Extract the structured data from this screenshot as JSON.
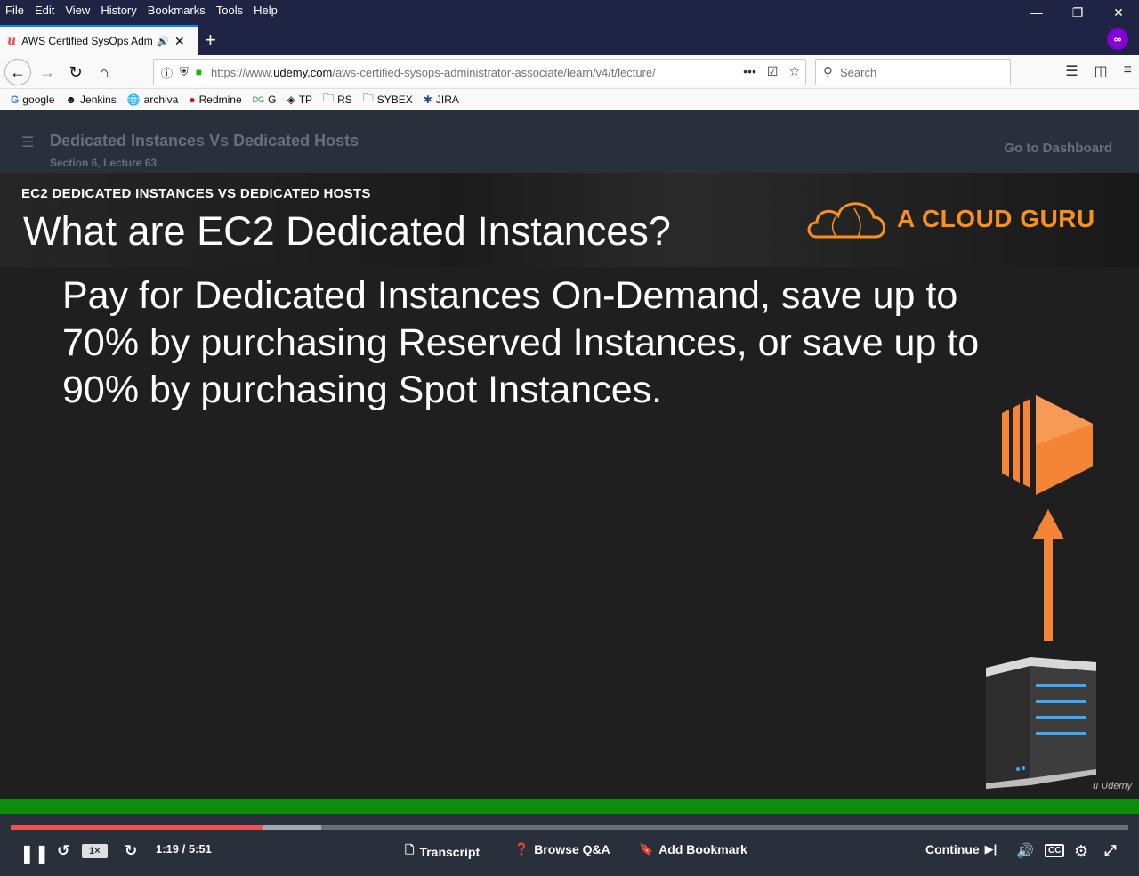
{
  "menu": [
    "File",
    "Edit",
    "View",
    "History",
    "Bookmarks",
    "Tools",
    "Help"
  ],
  "tab": {
    "title": "AWS Certified SysOps Administrator"
  },
  "url": {
    "prefix": "https://www.",
    "domain": "udemy.com",
    "path": "/aws-certified-sysops-administrator-associate/learn/v4/t/lecture/"
  },
  "search": {
    "placeholder": "Search"
  },
  "bookmarks": [
    "google",
    "Jenkins",
    "archiva",
    "Redmine",
    "G",
    "TP",
    "RS",
    "SYBEX",
    "JIRA"
  ],
  "lecture": {
    "title": "Dedicated Instances Vs Dedicated Hosts",
    "subtitle": "Section 6, Lecture 63",
    "dashboard": "Go to Dashboard"
  },
  "slide": {
    "kicker": "EC2 DEDICATED INSTANCES VS DEDICATED HOSTS",
    "title": "What are EC2 Dedicated Instances?",
    "brand": "A CLOUD GURU",
    "body": "Pay for Dedicated Instances On-Demand, save up to 70% by purchasing Reserved Instances, or save up to 90% by purchasing Spot Instances.",
    "watermark": "Udemy"
  },
  "player": {
    "speed": "1×",
    "time": "1:19 / 5:51",
    "played_fraction": 0.226,
    "buffered_fraction": 0.278,
    "transcript": "Transcript",
    "qa": "Browse Q&A",
    "bookmark": "Add Bookmark",
    "continue": "Continue"
  },
  "colors": {
    "accent": "#ec5252",
    "brand": "#f7901e",
    "header": "#29303b",
    "firefox_dark": "#1f2445",
    "green_bar": "#0f8c0f"
  }
}
